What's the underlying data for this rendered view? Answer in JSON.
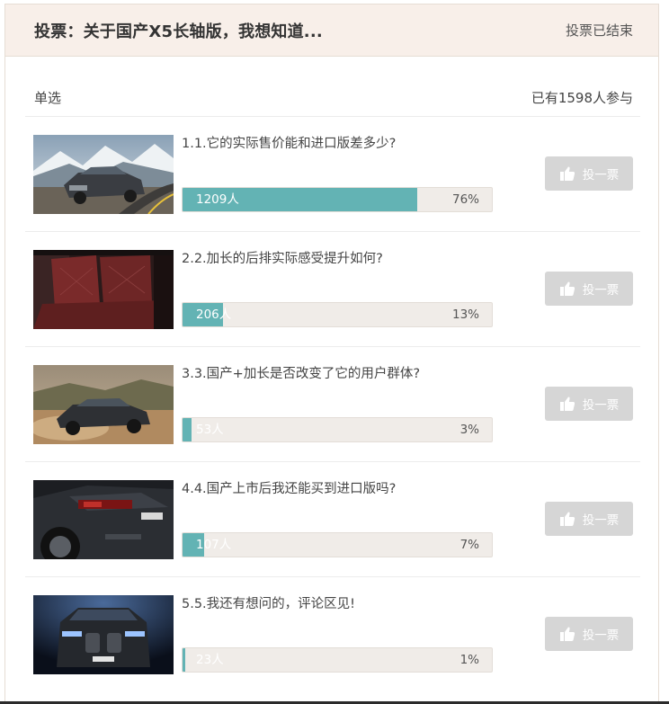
{
  "poll": {
    "title": "投票：关于国产X5长轴版，我想知道...",
    "status": "投票已结束",
    "type_label": "单选",
    "participants": "已有1598人参与",
    "accent_color": "#63b3b4",
    "options": [
      {
        "label": "1.1.它的实际售价能和进口版差多少?",
        "count": "1209人",
        "percent": "76%",
        "share": 0.76,
        "vote_label": "投一票",
        "image": "car-front-road-photo"
      },
      {
        "label": "2.2.加长的后排实际感受提升如何?",
        "count": "206人",
        "percent": "13%",
        "share": 0.13,
        "vote_label": "投一票",
        "image": "rear-seat-interior-photo"
      },
      {
        "label": "3.3.国产+加长是否改变了它的用户群体?",
        "count": "53人",
        "percent": "3%",
        "share": 0.03,
        "vote_label": "投一票",
        "image": "car-side-dirt-road-photo"
      },
      {
        "label": "4.4.国产上市后我还能买到进口版吗?",
        "count": "107人",
        "percent": "7%",
        "share": 0.07,
        "vote_label": "投一票",
        "image": "car-rear-detail-photo"
      },
      {
        "label": "5.5.我还有想问的，评论区见!",
        "count": "23人",
        "percent": "1%",
        "share": 0.01,
        "vote_label": "投一票",
        "image": "car-front-grille-photo"
      }
    ]
  }
}
